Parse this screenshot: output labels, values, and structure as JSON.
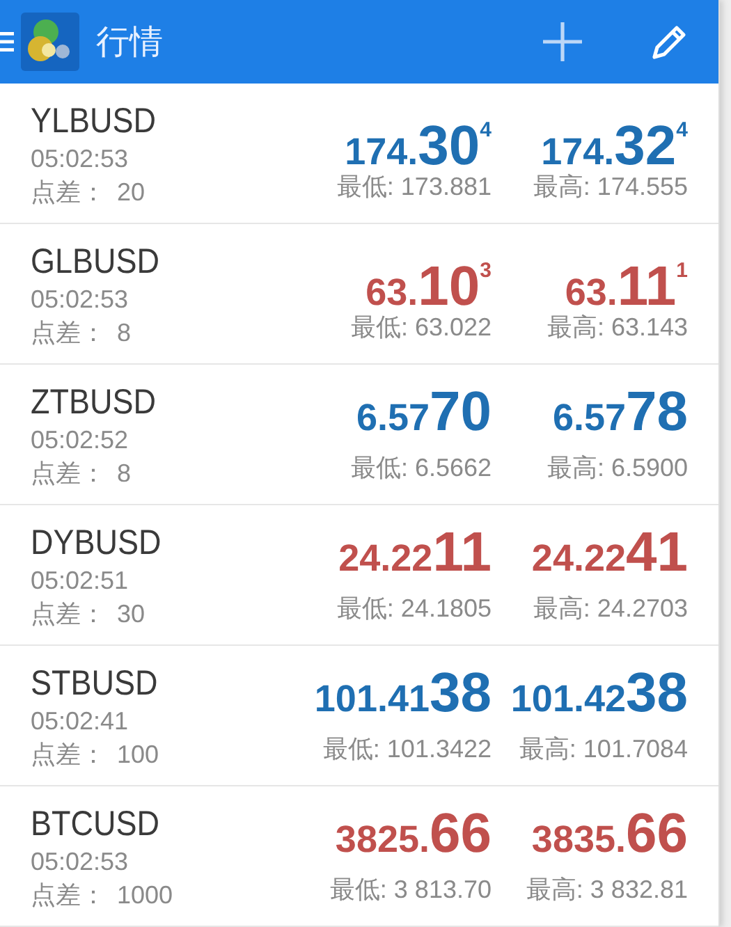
{
  "app_bar": {
    "title": "行情"
  },
  "symbols": [
    {
      "name": "YLBUSD",
      "time": "05:02:53",
      "spread_label": "点差：",
      "spread": "20",
      "color": "#1f6fb2",
      "bid": {
        "prefix": "174.",
        "big": "30",
        "sup": "4"
      },
      "ask": {
        "prefix": "174.",
        "big": "32",
        "sup": "4"
      },
      "low": "最低: 173.881",
      "high": "最高: 174.555"
    },
    {
      "name": "GLBUSD",
      "time": "05:02:53",
      "spread_label": "点差：",
      "spread": "8",
      "color": "#c0504d",
      "bid": {
        "prefix": "63.",
        "big": "10",
        "sup": "3"
      },
      "ask": {
        "prefix": "63.",
        "big": "11",
        "sup": "1"
      },
      "low": "最低: 63.022",
      "high": "最高: 63.143"
    },
    {
      "name": "ZTBUSD",
      "time": "05:02:52",
      "spread_label": "点差：",
      "spread": "8",
      "color": "#1f6fb2",
      "bid": {
        "prefix": "6.57",
        "big": "70"
      },
      "ask": {
        "prefix": "6.57",
        "big": "78"
      },
      "low": "最低: 6.5662",
      "high": "最高: 6.5900"
    },
    {
      "name": "DYBUSD",
      "time": "05:02:51",
      "spread_label": "点差：",
      "spread": "30",
      "color": "#c0504d",
      "bid": {
        "prefix": "24.22",
        "big": "11"
      },
      "ask": {
        "prefix": "24.22",
        "big": "41"
      },
      "low": "最低: 24.1805",
      "high": "最高: 24.2703"
    },
    {
      "name": "STBUSD",
      "time": "05:02:41",
      "spread_label": "点差：",
      "spread": "100",
      "color": "#1f6fb2",
      "bid": {
        "prefix": "101.41",
        "big": "38"
      },
      "ask": {
        "prefix": "101.42",
        "big": "38"
      },
      "low": "最低: 101.3422",
      "high": "最高: 101.7084"
    },
    {
      "name": "BTCUSD",
      "time": "05:02:53",
      "spread_label": "点差：",
      "spread": "1000",
      "color": "#c0504d",
      "bid": {
        "prefix": "3825.",
        "big": "66"
      },
      "ask": {
        "prefix": "3835.",
        "big": "66"
      },
      "low": "最低: 3 813.70",
      "high": "最高: 3 832.81"
    }
  ]
}
